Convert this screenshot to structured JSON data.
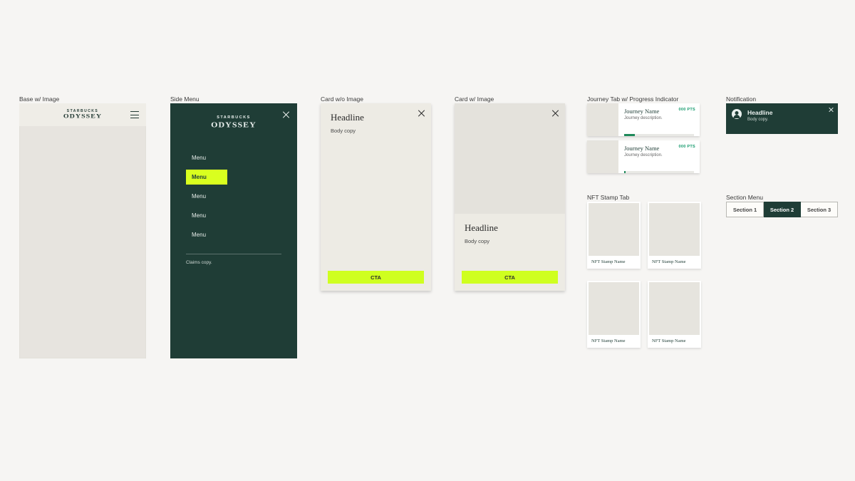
{
  "labels": {
    "base": "Base w/ Image",
    "sidemenu": "Side Menu",
    "card_noimg": "Card w/o Image",
    "card_img": "Card w/ Image",
    "journey": "Journey Tab w/ Progress Indicator",
    "nft": "NFT Stamp Tab",
    "notification": "Notification",
    "section_menu": "Section Menu"
  },
  "brand": {
    "top": "STARBUCKS",
    "bottom": "ODYSSEY"
  },
  "sideMenu": {
    "items": [
      {
        "label": "Menu"
      },
      {
        "label": "Menu"
      },
      {
        "label": "Menu"
      },
      {
        "label": "Menu"
      },
      {
        "label": "Menu"
      }
    ],
    "claims": "Claims copy."
  },
  "card_noimg": {
    "headline": "Headline",
    "body": "Body copy",
    "cta": "CTA"
  },
  "card_img": {
    "headline": "Headline",
    "body": "Body copy",
    "cta": "CTA"
  },
  "journeys": [
    {
      "name": "Journey Name",
      "desc": "Journey description.",
      "pts": "000 PTS",
      "progress": 15
    },
    {
      "name": "Journey Name",
      "desc": "Journey description.",
      "pts": "000 PTS",
      "progress": 2
    }
  ],
  "stamps": [
    {
      "name": "NFT Stamp Name"
    },
    {
      "name": "NFT Stamp Name"
    },
    {
      "name": "NFT Stamp Name"
    },
    {
      "name": "NFT Stamp Name"
    }
  ],
  "notification": {
    "headline": "Headline",
    "body": "Body copy."
  },
  "sections": [
    {
      "label": "Section 1"
    },
    {
      "label": "Section 2"
    },
    {
      "label": "Section 3"
    }
  ],
  "colors": {
    "green": "#1f3d36",
    "lime": "#cfff1f",
    "cream": "#edebe4"
  }
}
